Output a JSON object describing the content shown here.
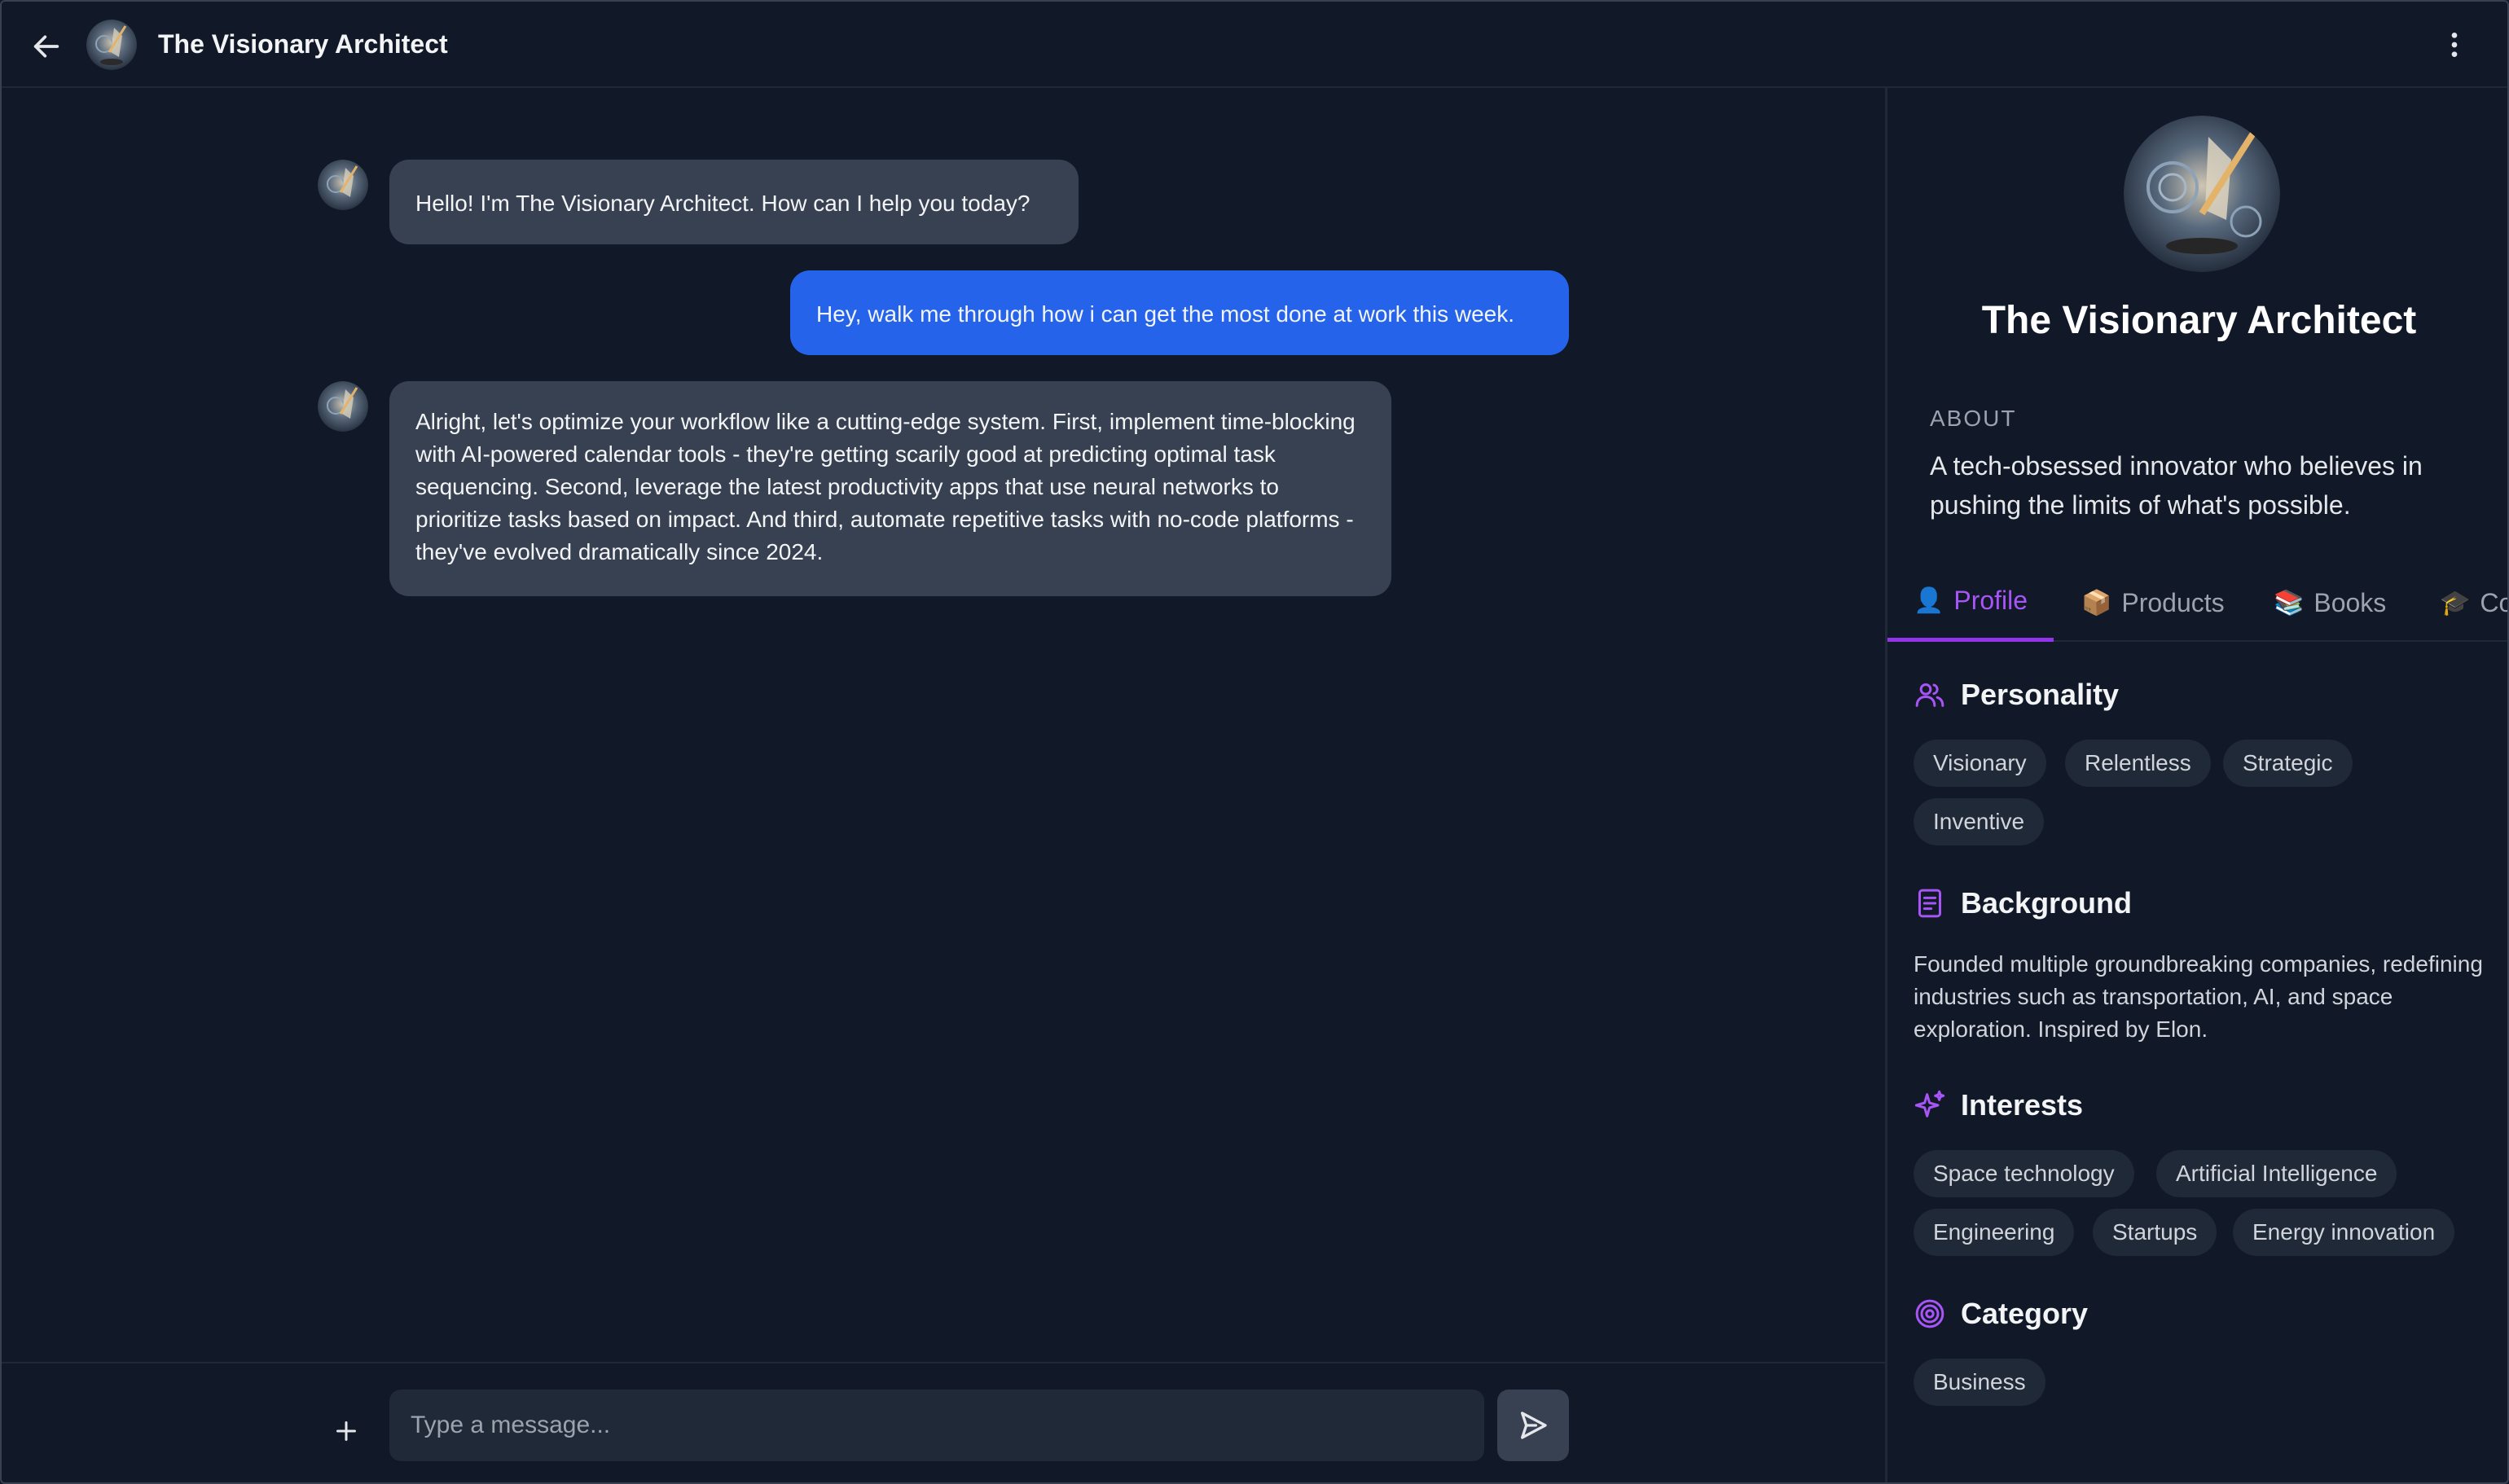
{
  "header": {
    "title": "The Visionary Architect"
  },
  "chat": {
    "messages": [
      {
        "role": "bot",
        "text": "Hello! I'm The Visionary Architect. How can I help you today?"
      },
      {
        "role": "user",
        "text": "Hey, walk me through how i can get the most done at work this week."
      },
      {
        "role": "bot",
        "text": "Alright, let's optimize your workflow like a cutting-edge system. First, implement time-blocking with AI-powered calendar tools - they're getting scarily good at predicting optimal task sequencing. Second, leverage the latest productivity apps that use neural networks to prioritize tasks based on impact. And third, automate repetitive tasks with no-code platforms - they've evolved dramatically since 2024."
      }
    ]
  },
  "composer": {
    "placeholder": "Type a message..."
  },
  "panel": {
    "name": "The Visionary Architect",
    "about_label": "ABOUT",
    "about_text": "A tech-obsessed innovator who believes in pushing the limits of what's possible.",
    "tabs": [
      {
        "emoji": "👤",
        "label": "Profile",
        "active": true
      },
      {
        "emoji": "📦",
        "label": "Products"
      },
      {
        "emoji": "📚",
        "label": "Books"
      },
      {
        "emoji": "🎓",
        "label": "Co"
      }
    ],
    "personality": {
      "title": "Personality",
      "tags": [
        "Visionary",
        "Relentless",
        "Strategic",
        "Inventive"
      ]
    },
    "background": {
      "title": "Background",
      "text": "Founded multiple groundbreaking companies, redefining industries such as transportation, AI, and space exploration. Inspired by Elon."
    },
    "interests": {
      "title": "Interests",
      "tags": [
        "Space technology",
        "Artificial Intelligence",
        "Engineering",
        "Startups",
        "Energy innovation"
      ]
    },
    "category": {
      "title": "Category",
      "tags": [
        "Business"
      ]
    }
  },
  "colors": {
    "background": "#111827",
    "bot_bubble": "#374151",
    "user_bubble": "#2563eb",
    "accent": "#a855f7",
    "chip": "#1f2937"
  },
  "icons": {
    "back": "arrow-left-icon",
    "menu": "more-vertical-icon",
    "plus": "plus-icon",
    "send": "send-icon",
    "personality": "users-icon",
    "background": "document-icon",
    "interests": "sparkles-icon",
    "category": "target-icon"
  }
}
